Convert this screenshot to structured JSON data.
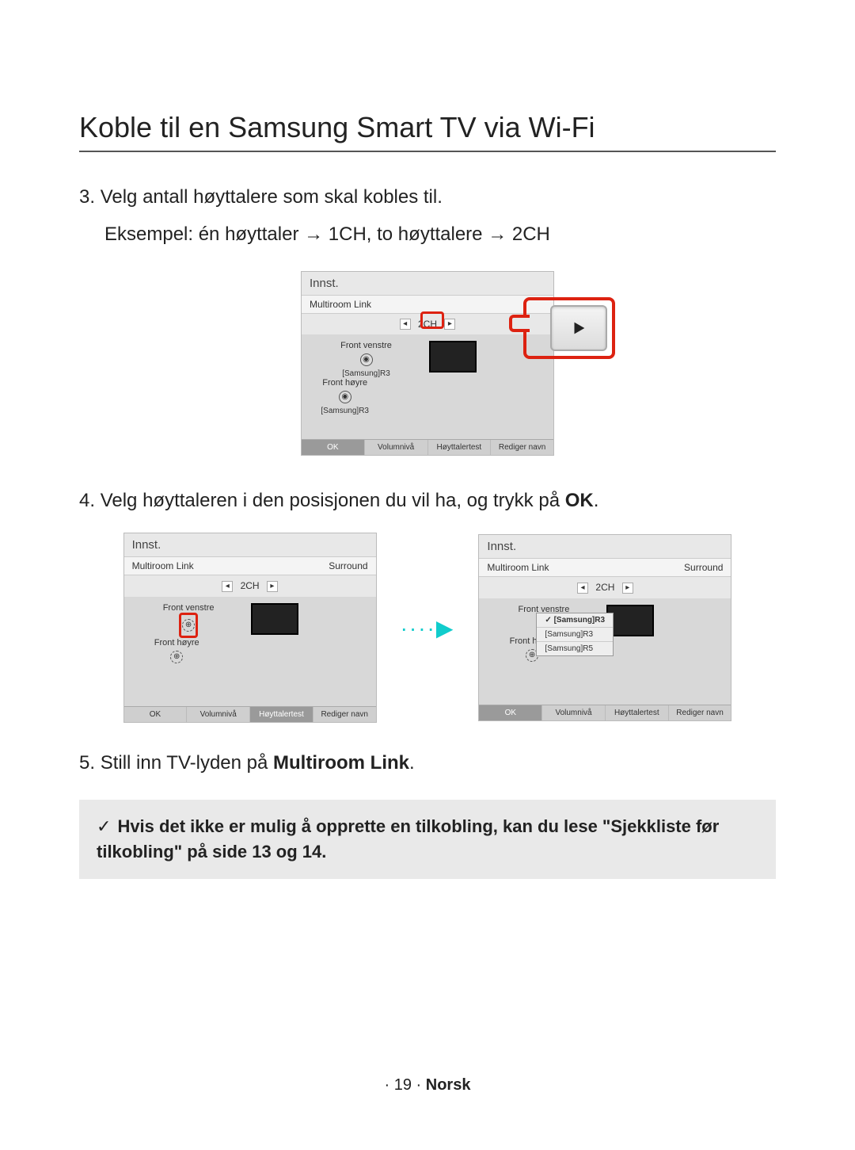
{
  "page": {
    "title": "Koble til en Samsung Smart TV via Wi-Fi",
    "footer_page": "· 19 ·",
    "footer_lang": "Norsk"
  },
  "steps": {
    "s3_num": "3.",
    "s3_text": "Velg antall høyttalere som skal kobles til.",
    "s3_example_a": "Eksempel: én høyttaler ",
    "s3_example_b": " 1CH, to høyttalere ",
    "s3_example_c": " 2CH",
    "arrow": "→",
    "s4_num": "4.",
    "s4_text_a": "Velg høyttaleren i den posisjonen du vil ha, og trykk på ",
    "s4_text_b": "OK",
    "s4_text_c": ".",
    "s5_num": "5.",
    "s5_text_a": "Still inn TV-lyden på ",
    "s5_text_b": "Multiroom Link",
    "s5_text_c": "."
  },
  "note": {
    "check": "✓",
    "text": "Hvis det ikke er mulig å opprette en tilkobling, kan du lese \"Sjekkliste før tilkobling\" på side 13 og 14."
  },
  "tv": {
    "title": "Innst.",
    "sub": "Multiroom Link",
    "mode_surround": "Surround",
    "ch": "2CH",
    "left_arrow": "◂",
    "right_arrow": "▸",
    "front_left": "Front venstre",
    "front_right": "Front høyre",
    "speaker_a": "[Samsung]R3",
    "speaker_b": "[Samsung]R3",
    "footer": {
      "ok": "OK",
      "vol": "Volumnivå",
      "test": "Høyttalertest",
      "edit": "Rediger navn"
    }
  },
  "dropdown": {
    "opt1": "[Samsung]R3",
    "opt2": "[Samsung]R3",
    "opt3": "[Samsung]R5"
  },
  "dots": "····▶"
}
